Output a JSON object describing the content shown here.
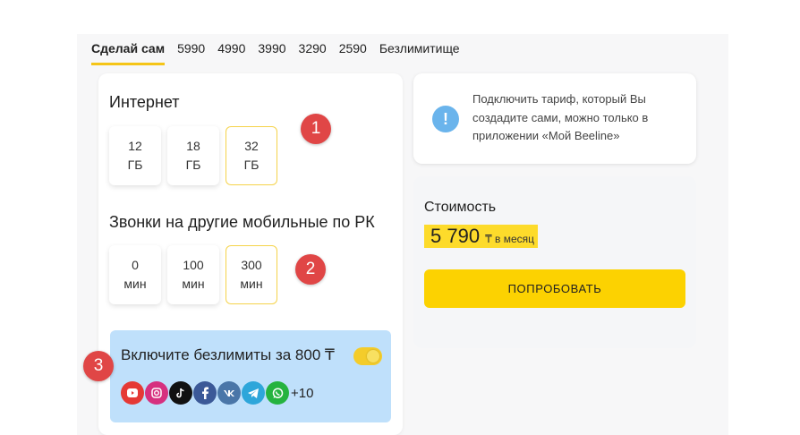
{
  "tabs": [
    {
      "label": "Сделай сам",
      "active": true
    },
    {
      "label": "5990"
    },
    {
      "label": "4990"
    },
    {
      "label": "3990"
    },
    {
      "label": "3290"
    },
    {
      "label": "2590"
    },
    {
      "label": "Безлимитище"
    }
  ],
  "internet": {
    "title": "Интернет",
    "options": [
      {
        "value": "12",
        "unit": "ГБ"
      },
      {
        "value": "18",
        "unit": "ГБ"
      },
      {
        "value": "32",
        "unit": "ГБ",
        "selected": true
      }
    ]
  },
  "calls": {
    "title": "Звонки на другие мобильные по РК",
    "options": [
      {
        "value": "0",
        "unit": "мин"
      },
      {
        "value": "100",
        "unit": "мин"
      },
      {
        "value": "300",
        "unit": "мин",
        "selected": true
      }
    ]
  },
  "badges": [
    "1",
    "2",
    "3"
  ],
  "unlim": {
    "title": "Включите безлимиты за 800 ₸",
    "toggle_on": true,
    "apps": [
      {
        "icon": "youtube-icon",
        "color": "#e53935"
      },
      {
        "icon": "instagram-icon",
        "color": "#d6307f"
      },
      {
        "icon": "tiktok-icon",
        "color": "#111111"
      },
      {
        "icon": "facebook-icon",
        "color": "#3b5998"
      },
      {
        "icon": "vk-icon",
        "color": "#4a76a8"
      },
      {
        "icon": "telegram-icon",
        "color": "#2ea6da"
      },
      {
        "icon": "whatsapp-icon",
        "color": "#25b33f"
      }
    ],
    "more": "+10"
  },
  "info": {
    "icon": "exclamation-icon",
    "text": "Подключить тариф, который Вы создадите сами, можно только в приложении «Мой Beeline»"
  },
  "price": {
    "label": "Стоимость",
    "value": "5 790",
    "unit": "₸ в месяц"
  },
  "cta": {
    "label": "ПОПРОБОВАТЬ"
  },
  "colors": {
    "accent": "#fcd201",
    "badge": "#e04646",
    "unlim_bg": "#bfe0fb",
    "info_icon": "#6ab4ec"
  }
}
